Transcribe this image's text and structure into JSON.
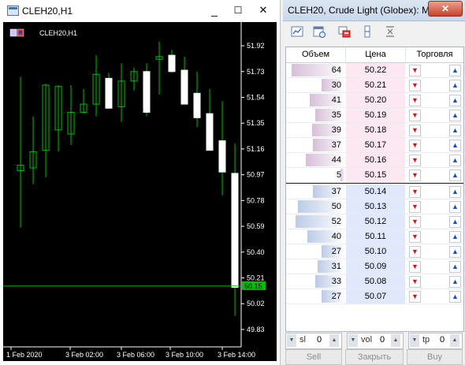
{
  "chart_window": {
    "title": "CLEH20,H1",
    "minimize": "_",
    "maximize": "☐",
    "close": "✕",
    "inner_label": "CLEH20,H1"
  },
  "colors": {
    "chart_bg": "#000000",
    "candle": "#ffffff",
    "wick": "#00c000",
    "bid_line": "#00c000",
    "ask_row": "#fde8f2",
    "bid_row": "#dfe9fb",
    "ask_bar": "#d7bfd8",
    "bid_bar": "#bccbe6"
  },
  "chart_data": {
    "type": "candlestick",
    "symbol": "CLEH20",
    "timeframe": "H1",
    "y_ticks": [
      "51.92",
      "51.73",
      "51.54",
      "51.35",
      "51.16",
      "50.97",
      "50.78",
      "50.59",
      "50.40",
      "50.21",
      "50.02",
      "49.83"
    ],
    "x_ticks": [
      "1 Feb 2020",
      "3 Feb 02:00",
      "3 Feb 06:00",
      "3 Feb 10:00",
      "3 Feb 14:00"
    ],
    "ylim": [
      49.76,
      51.99
    ],
    "current_price": "50.15",
    "candles": [
      {
        "o": 51.0,
        "h": 51.69,
        "l": 50.58,
        "c": 51.04
      },
      {
        "o": 51.02,
        "h": 51.4,
        "l": 50.9,
        "c": 51.14
      },
      {
        "o": 51.15,
        "h": 51.64,
        "l": 50.95,
        "c": 51.63
      },
      {
        "o": 51.3,
        "h": 51.63,
        "l": 51.14,
        "c": 51.62
      },
      {
        "o": 51.27,
        "h": 51.63,
        "l": 51.19,
        "c": 51.43
      },
      {
        "o": 51.43,
        "h": 51.6,
        "l": 51.42,
        "c": 51.49
      },
      {
        "o": 51.49,
        "h": 51.85,
        "l": 51.4,
        "c": 51.71
      },
      {
        "o": 51.68,
        "h": 51.72,
        "l": 51.47,
        "c": 51.46
      },
      {
        "o": 51.47,
        "h": 51.79,
        "l": 51.36,
        "c": 51.66
      },
      {
        "o": 51.66,
        "h": 51.76,
        "l": 51.59,
        "c": 51.73
      },
      {
        "o": 51.73,
        "h": 51.79,
        "l": 51.4,
        "c": 51.43
      },
      {
        "o": 51.82,
        "h": 51.95,
        "l": 51.56,
        "c": 51.84
      },
      {
        "o": 51.85,
        "h": 51.89,
        "l": 51.72,
        "c": 51.73
      },
      {
        "o": 51.74,
        "h": 51.84,
        "l": 51.49,
        "c": 51.49
      },
      {
        "o": 51.57,
        "h": 51.73,
        "l": 51.32,
        "c": 51.39
      },
      {
        "o": 51.42,
        "h": 51.6,
        "l": 51.17,
        "c": 51.15
      },
      {
        "o": 51.22,
        "h": 51.51,
        "l": 50.82,
        "c": 50.99
      },
      {
        "o": 50.98,
        "h": 51.2,
        "l": 49.93,
        "c": 50.14
      }
    ]
  },
  "dom_window": {
    "title": "CLEH20, Crude Light (Globex): M...",
    "close": "✕",
    "toolbar_icons": [
      "chart-icon",
      "calendar-icon",
      "trade-icon",
      "level-icon",
      "expand-icon"
    ],
    "headers": {
      "volume": "Объем",
      "price": "Цена",
      "trade": "Торговля"
    },
    "asks": [
      {
        "volume": "64",
        "price": "50.22",
        "bar": 0.45
      },
      {
        "volume": "30",
        "price": "50.21",
        "bar": 0.2
      },
      {
        "volume": "41",
        "price": "50.20",
        "bar": 0.3
      },
      {
        "volume": "35",
        "price": "50.19",
        "bar": 0.25
      },
      {
        "volume": "39",
        "price": "50.18",
        "bar": 0.28
      },
      {
        "volume": "37",
        "price": "50.17",
        "bar": 0.27
      },
      {
        "volume": "44",
        "price": "50.16",
        "bar": 0.33
      },
      {
        "volume": "5",
        "price": "50.15",
        "bar": 0.04
      }
    ],
    "bids": [
      {
        "volume": "37",
        "price": "50.14",
        "bar": 0.27
      },
      {
        "volume": "50",
        "price": "50.13",
        "bar": 0.4
      },
      {
        "volume": "52",
        "price": "50.12",
        "bar": 0.42
      },
      {
        "volume": "40",
        "price": "50.11",
        "bar": 0.32
      },
      {
        "volume": "27",
        "price": "50.10",
        "bar": 0.2
      },
      {
        "volume": "31",
        "price": "50.09",
        "bar": 0.23
      },
      {
        "volume": "33",
        "price": "50.08",
        "bar": 0.25
      },
      {
        "volume": "27",
        "price": "50.07",
        "bar": 0.2
      }
    ],
    "sl": {
      "label": "sl",
      "value": "0"
    },
    "vol": {
      "label": "vol",
      "value": "0"
    },
    "tp": {
      "label": "tp",
      "value": "0"
    },
    "sell_label": "Sell",
    "close_label": "Закрыть",
    "buy_label": "Buy"
  }
}
